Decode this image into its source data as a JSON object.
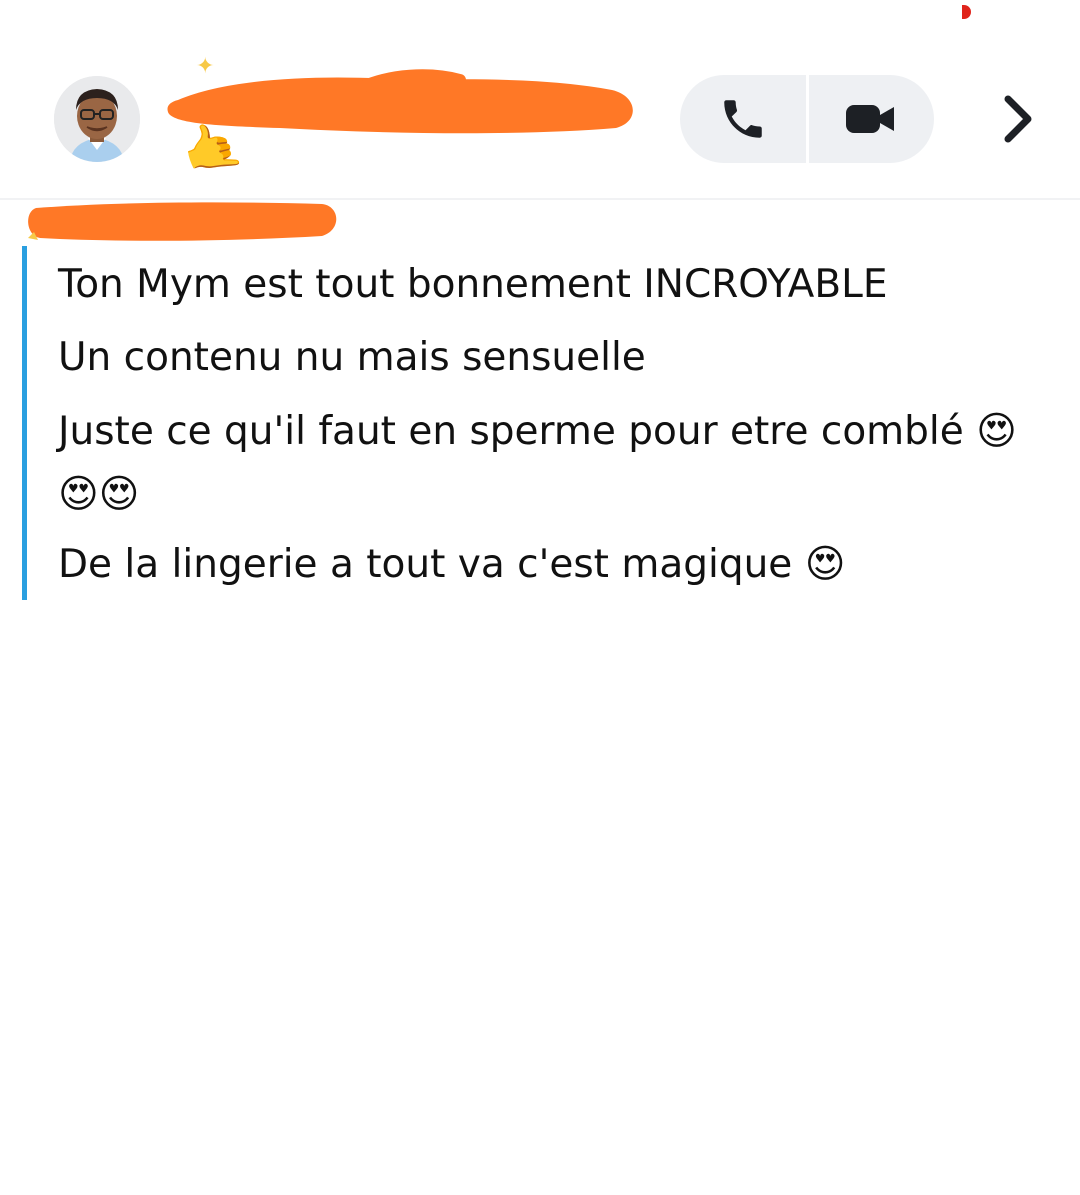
{
  "header": {
    "avatar_icon": "bitmoji-avatar-icon",
    "sparkle_icon": "✦",
    "status_emoji": "🤙",
    "call_icon": "phone-icon",
    "video_icon": "video-camera-icon",
    "chevron_icon": "chevron-right-icon",
    "scribble_color": "#ff7826"
  },
  "message": {
    "accent_color": "#2a9fe0",
    "lines": [
      "Ton Mym est tout bonnement INCROYABLE",
      "Un contenu nu mais sensuelle",
      "Juste ce qu'il faut en sperme pour etre comblé 😍",
      "😍😍",
      "De la lingerie a tout va c'est magique 😍"
    ]
  }
}
